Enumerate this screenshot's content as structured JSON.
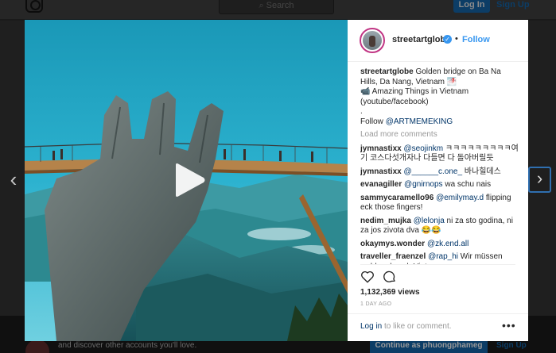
{
  "background": {
    "search_placeholder": "Search",
    "login_label": "Log In",
    "signup_label": "Sign Up",
    "banner_text": "and discover other accounts you'll love.",
    "continue_label": "Continue as phuongphameg",
    "banner_signup_label": "Sign Up"
  },
  "navigation": {
    "prev_icon": "chevron-left-icon",
    "next_icon": "chevron-right-icon"
  },
  "post": {
    "username": "streetartglobe",
    "verified_icon": "verified-check-icon",
    "dot": "•",
    "follow_label": "Follow",
    "caption": {
      "user": "streetartglobe",
      "line1": "Golden bridge on Ba Na Hills, Da Nang, Vietnam 🌁",
      "line2": "📹 Amazing Things in Vietnam (youtube/facebook)",
      "line3": ".",
      "follow_prefix": "Follow ",
      "follow_mention": "@ARTMEMEKING"
    },
    "load_more_label": "Load more comments",
    "comments": [
      {
        "user": "jymnastixx",
        "mention": "@seojinkm",
        "text": " ㅋㅋㅋㅋㅋㅋㅋㅋㅋ여기 코스다섯개자나 다들면 다 돌아버릴듯"
      },
      {
        "user": "jymnastixx",
        "mention": "@______c.one_",
        "text": " 바나힐데스"
      },
      {
        "user": "evanagiller",
        "mention": "@gnirnops",
        "text": " wa schu nais"
      },
      {
        "user": "sammycaramello96",
        "mention": "@emilymay.d",
        "text": " flipping eck those fingers!"
      },
      {
        "user": "nedim_mujka",
        "mention": "@lelonja",
        "text": " ni za sto godina, ni za jos zivota dva 😂😂"
      },
      {
        "user": "okaymys.wonder",
        "mention": "@zk.end.all",
        "text": ""
      },
      {
        "user": "traveller_fraenzel",
        "mention": "@rap_hi",
        "text": " Wir müssen wohl mal nach Vietnam"
      }
    ],
    "views": "1,132,369 views",
    "time": "1 DAY AGO",
    "login_link": "Log in",
    "login_suffix": " to like or comment.",
    "more_label": "•••",
    "icons": {
      "like": "heart-icon",
      "comment": "comment-icon",
      "play": "play-icon",
      "more": "more-options-icon"
    }
  },
  "colors": {
    "accent": "#3897f0",
    "link": "#003569",
    "muted": "#999999",
    "text": "#262626"
  }
}
